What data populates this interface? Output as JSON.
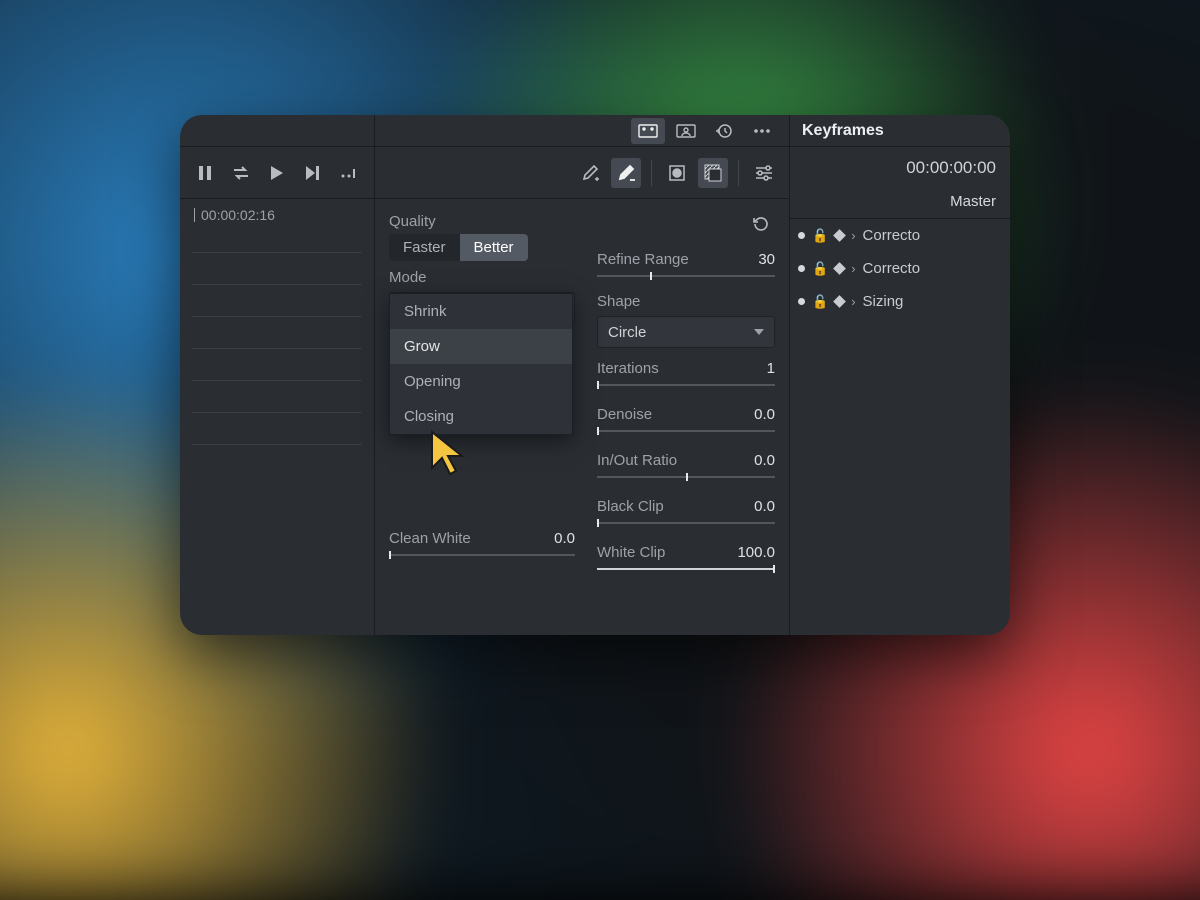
{
  "timeline": {
    "timecode": "00:00:02:16"
  },
  "quality": {
    "label": "Quality",
    "options": [
      "Faster",
      "Better"
    ],
    "selected": "Better"
  },
  "mode": {
    "label": "Mode",
    "selected": "Shrink",
    "options": [
      "Shrink",
      "Grow",
      "Opening",
      "Closing"
    ],
    "hovered": "Grow"
  },
  "clean_white": {
    "label": "Clean White",
    "value": "0.0"
  },
  "refine_range": {
    "label": "Refine Range",
    "value": "30"
  },
  "shape": {
    "label": "Shape",
    "selected": "Circle"
  },
  "iterations": {
    "label": "Iterations",
    "value": "1"
  },
  "denoise": {
    "label": "Denoise",
    "value": "0.0"
  },
  "inout_ratio": {
    "label": "In/Out Ratio",
    "value": "0.0"
  },
  "black_clip": {
    "label": "Black Clip",
    "value": "0.0"
  },
  "white_clip": {
    "label": "White Clip",
    "value": "100.0"
  },
  "keyframes": {
    "title": "Keyframes",
    "timecode": "00:00:00:00",
    "master": "Master",
    "rows": [
      "Correcto",
      "Correcto",
      "Sizing"
    ]
  },
  "icons": {
    "pause": "pause",
    "swap": "swap",
    "play": "play",
    "next": "next",
    "speed": "speed",
    "picker_add": "picker-add",
    "picker_minus": "picker-minus",
    "mask": "mask",
    "invert": "invert",
    "sliders": "sliders",
    "fx": "fx",
    "person": "person",
    "history": "history",
    "more": "more",
    "reset": "reset"
  }
}
